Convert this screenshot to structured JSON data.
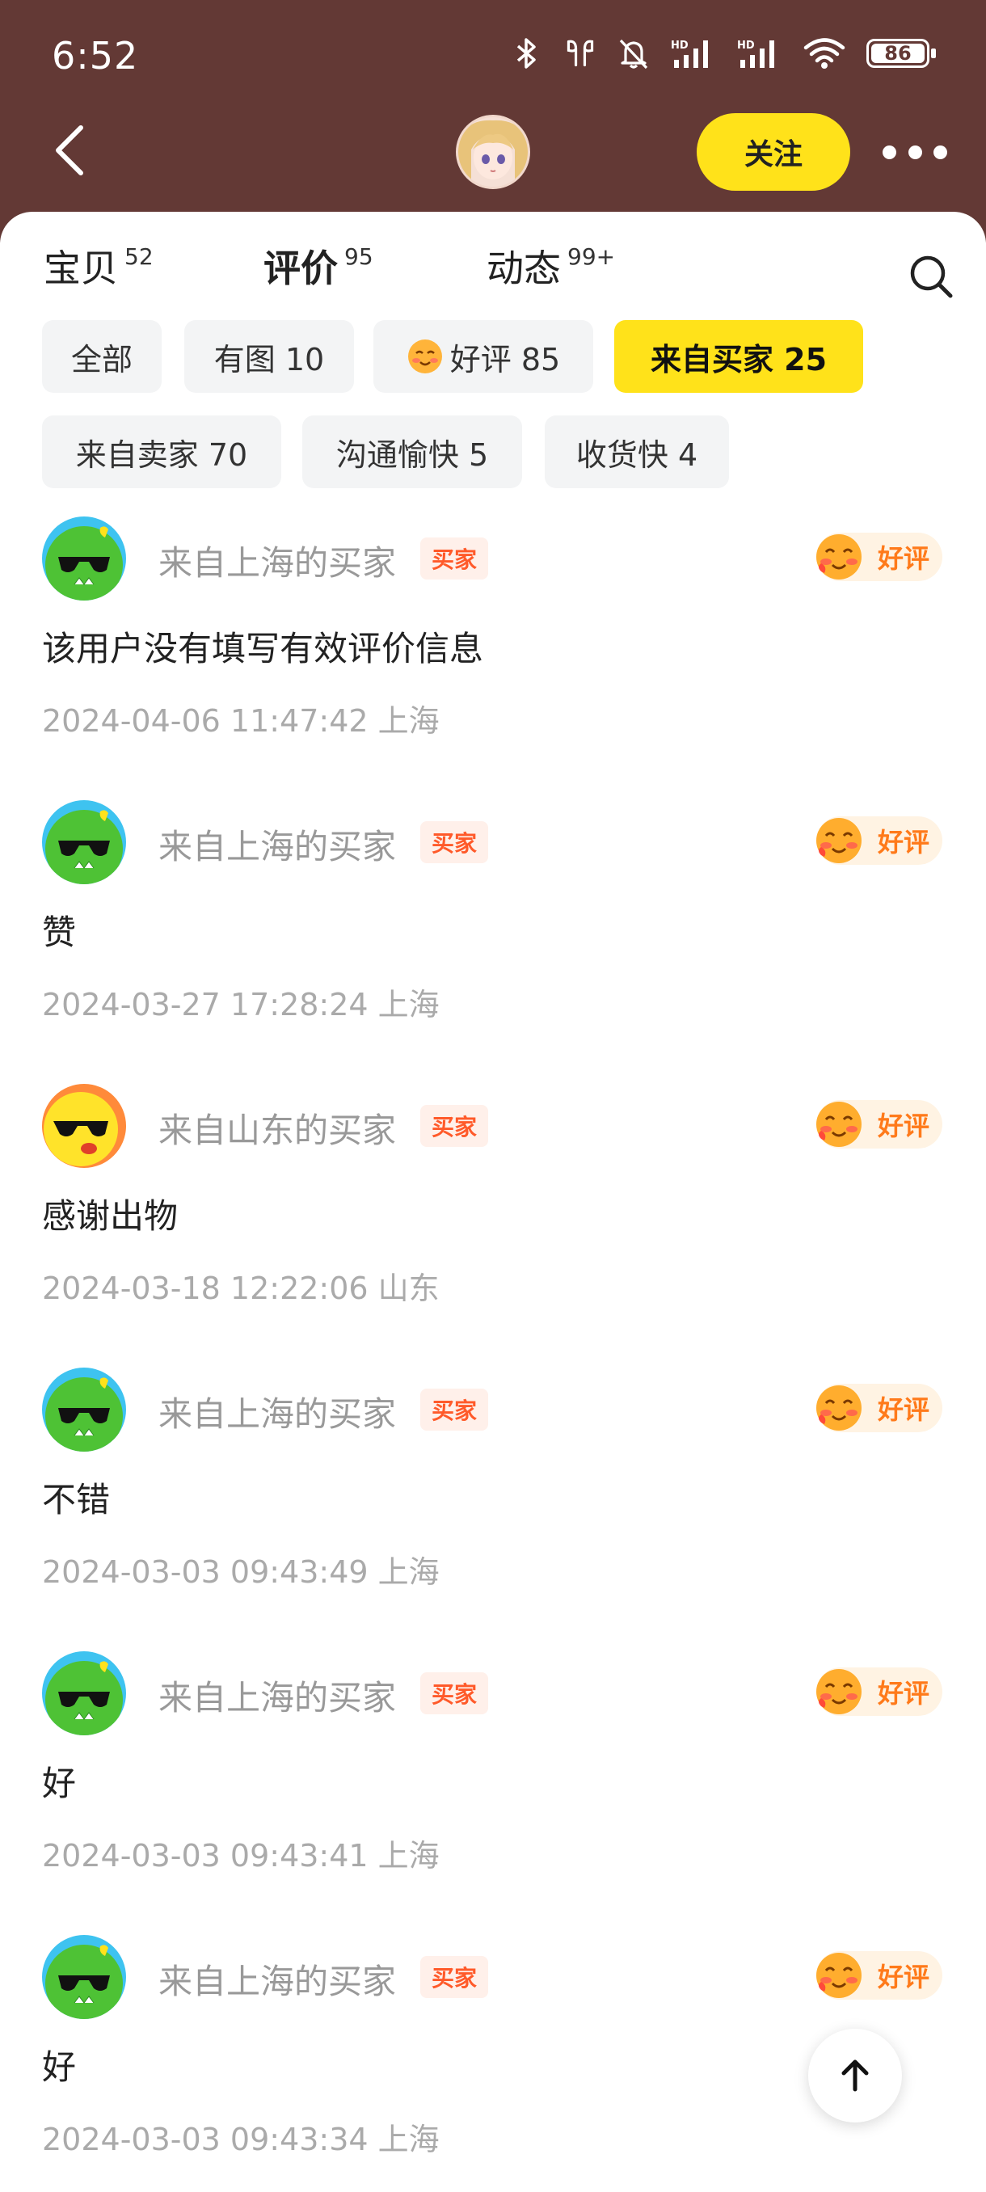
{
  "status_bar": {
    "time": "6:52",
    "battery": "86",
    "icons": [
      "bluetooth-icon",
      "earbuds-icon",
      "bell-muted-icon",
      "signal-hd-1-icon",
      "signal-hd-2-icon",
      "wifi-icon",
      "battery-icon"
    ]
  },
  "header": {
    "follow_label": "关注",
    "background": "#633935",
    "accent": "#ffe21a"
  },
  "tabs": [
    {
      "label": "宝贝",
      "count": "52"
    },
    {
      "label": "评价",
      "count": "95"
    },
    {
      "label": "动态",
      "count": "99+"
    }
  ],
  "chips": [
    {
      "label": "全部"
    },
    {
      "label": "有图 10"
    },
    {
      "label": "好评 85"
    },
    {
      "label": "来自买家 25"
    },
    {
      "label": "来自卖家 70"
    },
    {
      "label": "沟通愉快 5"
    },
    {
      "label": "收货快 4"
    }
  ],
  "reviews": [
    {
      "name": "来自上海的买家",
      "badge": "买家",
      "rating": "好评",
      "text": "该用户没有填写有效评价信息",
      "meta": "2024-04-06 11:47:42 上海"
    },
    {
      "name": "来自上海的买家",
      "badge": "买家",
      "rating": "好评",
      "text": "赞",
      "meta": "2024-03-27 17:28:24 上海"
    },
    {
      "name": "来自山东的买家",
      "badge": "买家",
      "rating": "好评",
      "text": "感谢出物",
      "meta": "2024-03-18 12:22:06 山东"
    },
    {
      "name": "来自上海的买家",
      "badge": "买家",
      "rating": "好评",
      "text": "不错",
      "meta": "2024-03-03 09:43:49 上海"
    },
    {
      "name": "来自上海的买家",
      "badge": "买家",
      "rating": "好评",
      "text": "好",
      "meta": "2024-03-03 09:43:41 上海"
    },
    {
      "name": "来自上海的买家",
      "badge": "买家",
      "rating": "好评",
      "text": "好",
      "meta": "2024-03-03 09:43:34 上海"
    }
  ]
}
